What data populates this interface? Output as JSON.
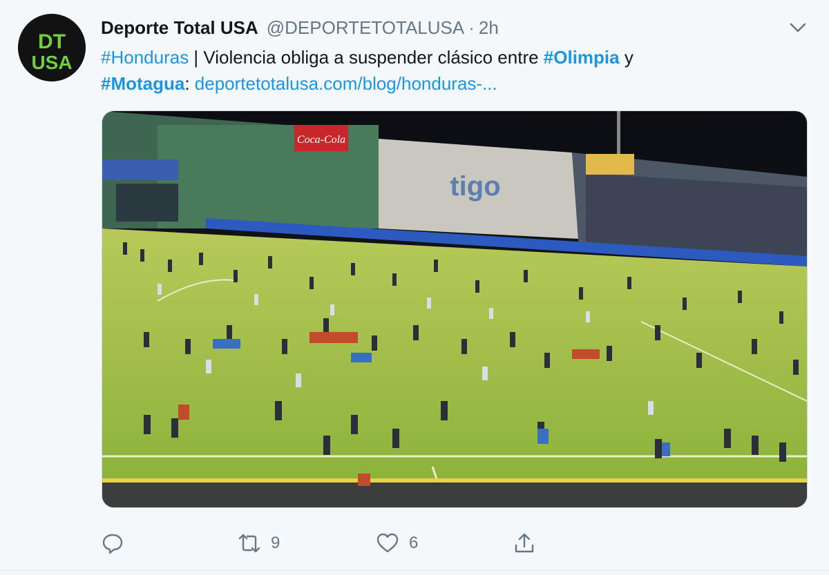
{
  "tweet": {
    "display_name": "Deporte Total USA",
    "handle": "@DEPORTETOTALUSA",
    "separator": "·",
    "timestamp": "2h",
    "avatar_text_top": "DT",
    "avatar_text_bottom": "USA",
    "text": {
      "tag_honduras": "#Honduras",
      "part1": " | Violencia obliga a suspender clásico entre ",
      "tag_olimpia": "#Olimpia",
      "part2": " y",
      "tag_motagua": "#Motagua",
      "part3": ": ",
      "link": "deportetotalusa.com/blog/honduras-..."
    },
    "media": {
      "banner_sponsor": "Coca-Cola",
      "stand_text": "tigo"
    },
    "actions": {
      "reply_icon": "reply-icon",
      "retweet_icon": "retweet-icon",
      "retweet_count": "9",
      "like_icon": "heart-icon",
      "like_count": "6",
      "share_icon": "share-icon"
    }
  },
  "colors": {
    "link": "#1b95e0",
    "muted": "#657786",
    "background": "#f5f8fa"
  }
}
